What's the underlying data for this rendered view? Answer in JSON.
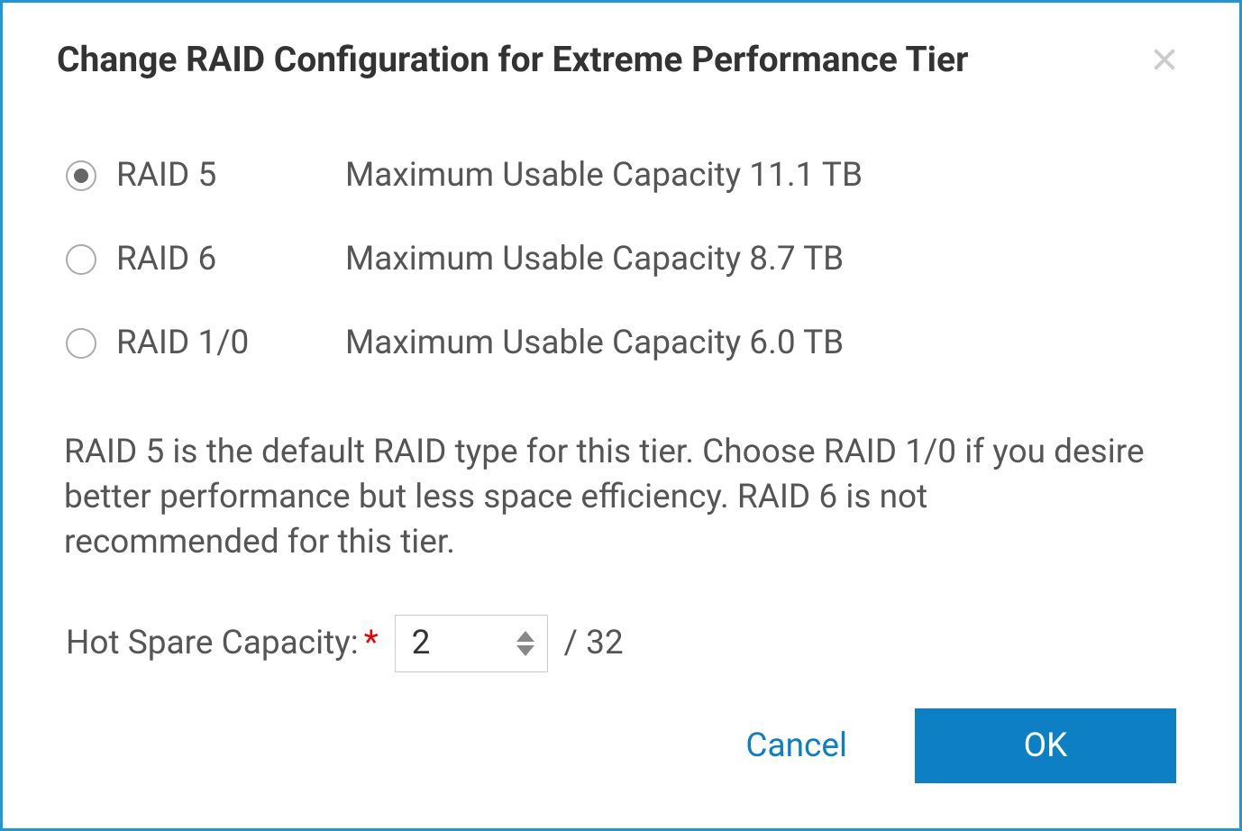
{
  "dialog": {
    "title": "Change RAID Configuration for Extreme Performance Tier"
  },
  "options": [
    {
      "label": "RAID 5",
      "capacity": "Maximum Usable Capacity 11.1 TB",
      "selected": true
    },
    {
      "label": "RAID 6",
      "capacity": "Maximum Usable Capacity 8.7 TB",
      "selected": false
    },
    {
      "label": "RAID 1/0",
      "capacity": "Maximum Usable Capacity 6.0 TB",
      "selected": false
    }
  ],
  "description": "RAID 5 is the default RAID type for this tier. Choose RAID 1/0 if you desire better performance but less space efficiency. RAID 6 is not recommended for this tier.",
  "hotSpare": {
    "label": "Hot Spare Capacity:",
    "value": "2",
    "max": "/ 32"
  },
  "footer": {
    "cancel": "Cancel",
    "ok": "OK"
  }
}
